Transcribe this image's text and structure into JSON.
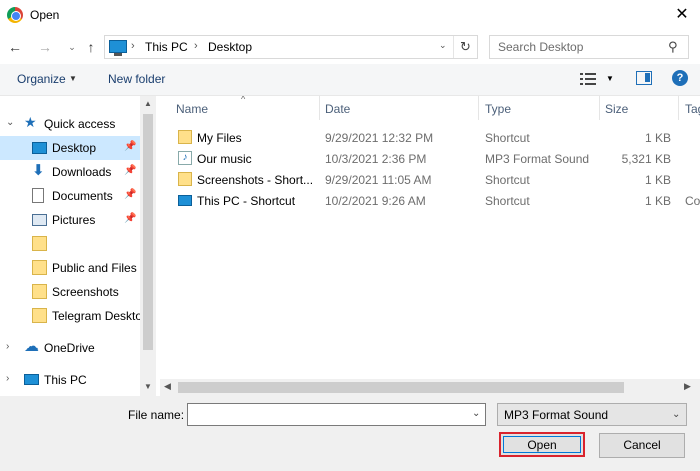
{
  "window": {
    "title": "Open"
  },
  "address": {
    "crumbs": [
      "This PC",
      "Desktop"
    ],
    "search_placeholder": "Search Desktop"
  },
  "toolbar": {
    "organize": "Organize",
    "new_folder": "New folder"
  },
  "nav": {
    "items": [
      {
        "label": "Quick access",
        "icon": "star-icon",
        "pinned": false
      },
      {
        "label": "Desktop",
        "icon": "desktop-icon",
        "pinned": true,
        "selected": true
      },
      {
        "label": "Downloads",
        "icon": "download-icon",
        "pinned": true
      },
      {
        "label": "Documents",
        "icon": "documents-icon",
        "pinned": true
      },
      {
        "label": "Pictures",
        "icon": "pictures-icon",
        "pinned": true
      },
      {
        "label": "",
        "icon": "folder-icon",
        "pinned": false
      },
      {
        "label": "Public and Files",
        "icon": "folder-icon",
        "pinned": false
      },
      {
        "label": "Screenshots",
        "icon": "folder-icon",
        "pinned": false
      },
      {
        "label": "Telegram Deskto",
        "icon": "folder-icon",
        "pinned": false
      },
      {
        "label": "OneDrive",
        "icon": "cloud-icon",
        "pinned": false
      },
      {
        "label": "This PC",
        "icon": "pc-icon",
        "pinned": false
      }
    ]
  },
  "columns": [
    "Name",
    "Date",
    "Type",
    "Size",
    "Tag"
  ],
  "files": [
    {
      "name": "My Files",
      "date": "9/29/2021 12:32 PM",
      "type": "Shortcut",
      "size": "1 KB",
      "tag": "",
      "icon": "folder-shortcut-icon"
    },
    {
      "name": "Our music",
      "date": "10/3/2021 2:36 PM",
      "type": "MP3 Format Sound",
      "size": "5,321 KB",
      "tag": "",
      "icon": "music-file-icon"
    },
    {
      "name": "Screenshots - Short...",
      "date": "9/29/2021 11:05 AM",
      "type": "Shortcut",
      "size": "1 KB",
      "tag": "",
      "icon": "folder-shortcut-icon"
    },
    {
      "name": "This PC - Shortcut",
      "date": "10/2/2021 9:26 AM",
      "type": "Shortcut",
      "size": "1 KB",
      "tag": "Co",
      "icon": "pc-shortcut-icon"
    }
  ],
  "bottom": {
    "filename_label": "File name:",
    "filename_value": "",
    "filetype": "MP3 Format Sound",
    "open_label": "Open",
    "cancel_label": "Cancel"
  },
  "colors": {
    "selection": "#cce8ff",
    "highlight_border": "#d9232d",
    "accent": "#0078d7"
  }
}
